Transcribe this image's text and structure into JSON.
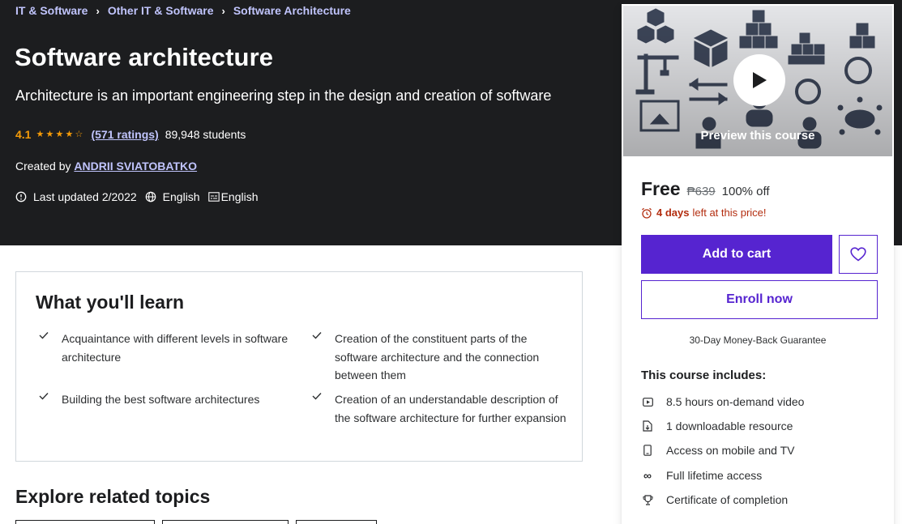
{
  "breadcrumb": [
    "IT & Software",
    "Other IT & Software",
    "Software Architecture"
  ],
  "course": {
    "title": "Software architecture",
    "subtitle": "Architecture is an important engineering step in the design and creation of software",
    "rating": "4.1",
    "rating_value": 4.1,
    "ratings_count": "(571 ratings)",
    "students": "89,948 students",
    "created_by_label": "Created by",
    "author": "ANDRII SVIATOBATKO",
    "last_updated": "Last updated 2/2022",
    "language": "English",
    "captions": "English"
  },
  "learn": {
    "title": "What you'll learn",
    "items": [
      "Acquaintance with different levels in software architecture",
      "Creation of the constituent parts of the software architecture and the connection between them",
      "Building the best software architectures",
      "Creation of an understandable description of the software architecture for further expansion"
    ]
  },
  "explore": {
    "title": "Explore related topics"
  },
  "sidebar": {
    "preview_label": "Preview this course",
    "price_now": "Free",
    "price_old": "₱639",
    "discount": "100% off",
    "deadline_bold": "4 days",
    "deadline_rest": "left at this price!",
    "add_to_cart": "Add to cart",
    "enroll_now": "Enroll now",
    "guarantee": "30-Day Money-Back Guarantee",
    "includes_title": "This course includes:",
    "includes": [
      {
        "icon": "video-icon",
        "text": "8.5 hours on-demand video"
      },
      {
        "icon": "file-download-icon",
        "text": "1 downloadable resource"
      },
      {
        "icon": "mobile-icon",
        "text": "Access on mobile and TV"
      },
      {
        "icon": "infinity-icon",
        "text": "Full lifetime access"
      },
      {
        "icon": "trophy-icon",
        "text": "Certificate of completion"
      }
    ]
  },
  "colors": {
    "hero_bg": "#1c1d1f",
    "accent_purple": "#5624d0",
    "link_lavender": "#c0c4fc",
    "star_orange": "#f69c08",
    "deadline_red": "#b32d0f"
  }
}
